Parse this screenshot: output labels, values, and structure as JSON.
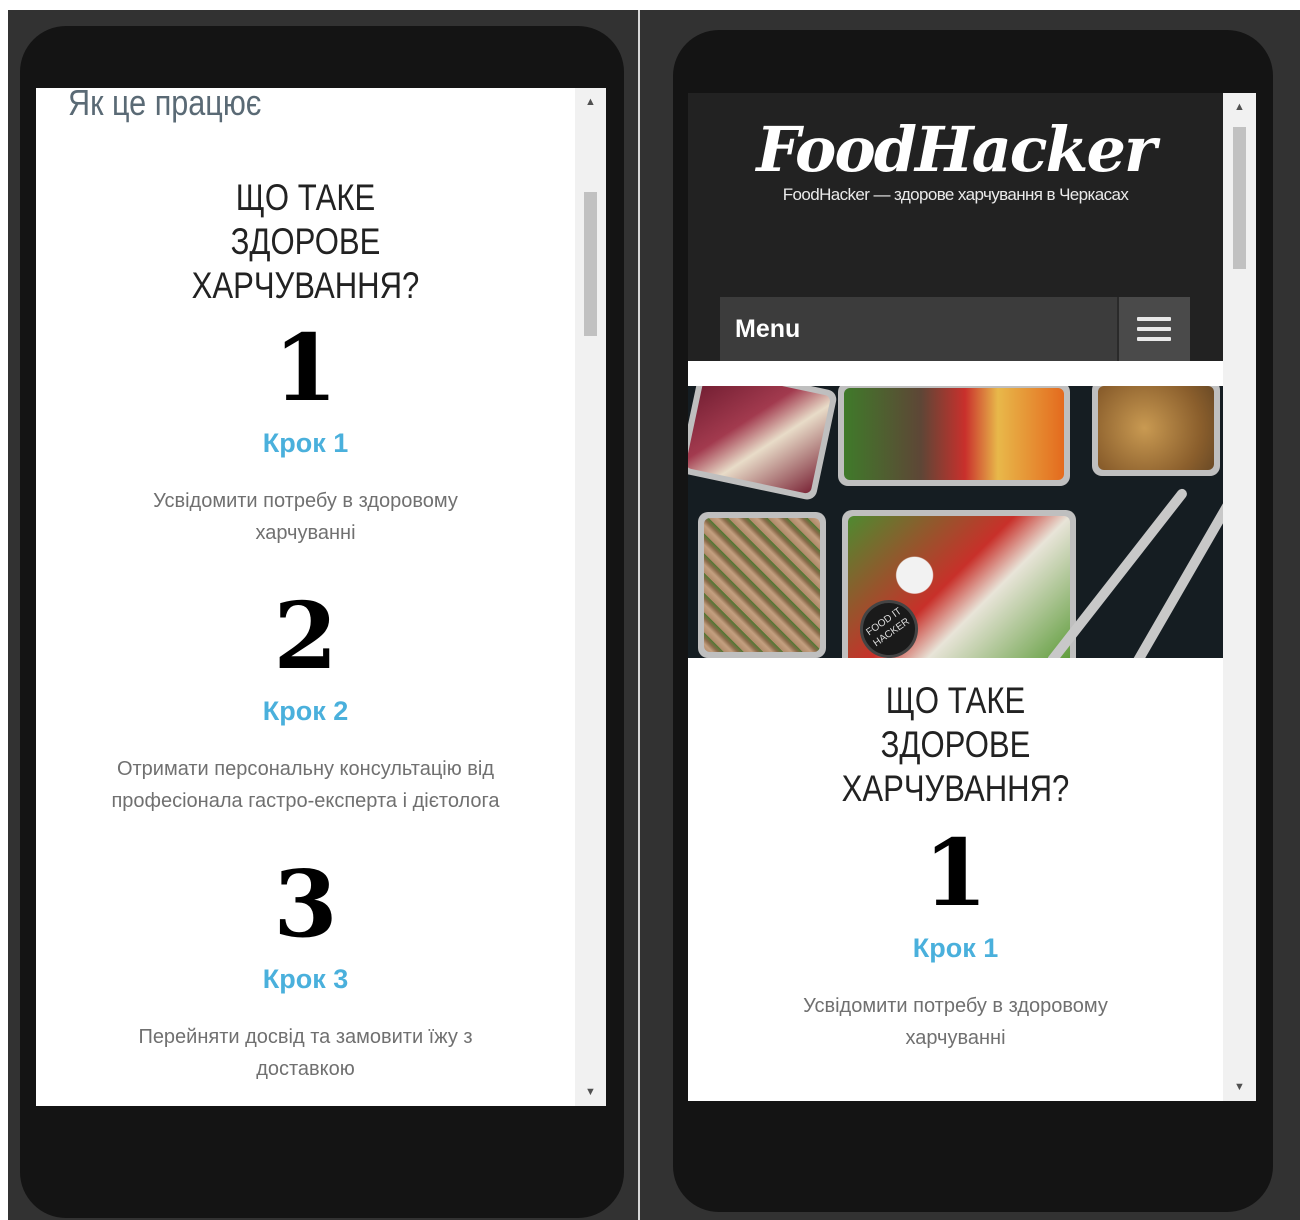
{
  "left_view": {
    "section_title": "Як це працює",
    "heading": "ЩО ТАКЕ ЗДОРОВЕ ХАРЧУВАННЯ?",
    "steps": [
      {
        "number": "1",
        "label": "Крок 1",
        "desc": "Усвідомити потребу в здоровому харчуванні"
      },
      {
        "number": "2",
        "label": "Крок 2",
        "desc": "Отримати персональну консультацію від професіонала гастро-експерта і дієтолога"
      },
      {
        "number": "3",
        "label": "Крок 3",
        "desc": "Перейняти досвід та замовити їжу з доставкою"
      }
    ]
  },
  "right_view": {
    "site_title": "FoodHacker",
    "tagline": "FoodHacker — здорове харчування в Черкасах",
    "menu_label": "Menu",
    "badge_text": "FOOD IT HACKER",
    "heading": "ЩО ТАКЕ ЗДОРОВЕ ХАРЧУВАННЯ?",
    "steps": [
      {
        "number": "1",
        "label": "Крок 1",
        "desc": "Усвідомити потребу в здоровому харчуванні"
      }
    ]
  },
  "colors": {
    "accent": "#4ab0dc",
    "header_bg": "#222222",
    "menu_bg": "#3c3c3c"
  },
  "icons": [
    "scroll-up-arrow-icon",
    "scroll-down-arrow-icon",
    "hamburger-menu-icon"
  ]
}
